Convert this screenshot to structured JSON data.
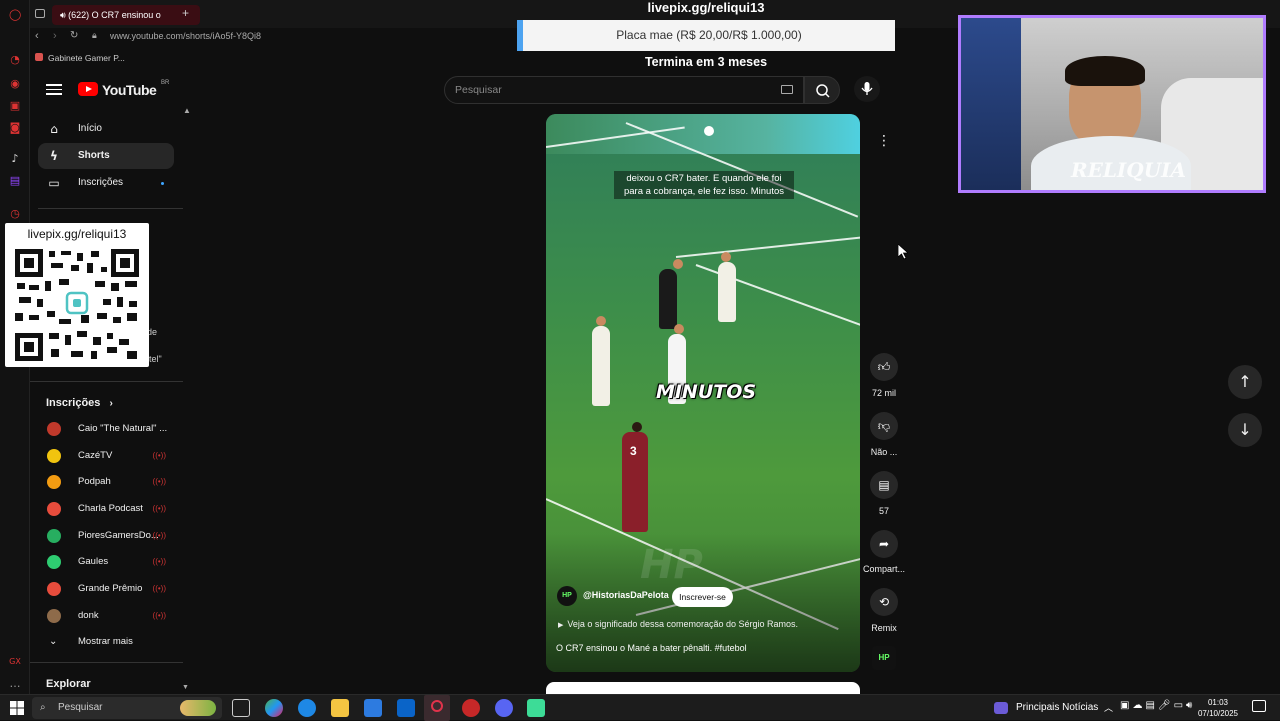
{
  "browser": {
    "tab_title": "(622) O CR7 ensinou o",
    "url": "www.youtube.com/shorts/iAo5f-Y8Qi8",
    "bookmark": "Gabinete Gamer P..."
  },
  "youtube": {
    "logo_text": "YouTube",
    "region": "BR",
    "search_placeholder": "Pesquisar",
    "nav": [
      {
        "label": "Início",
        "icon": "home-icon"
      },
      {
        "label": "Shorts",
        "icon": "shorts-icon"
      },
      {
        "label": "Inscrições",
        "icon": "subscriptions-icon"
      }
    ],
    "partial_sidebar_text": [
      "de",
      "tel\""
    ],
    "subscriptions_header": "Inscrições",
    "subscriptions": [
      {
        "name": "Caio \"The Natural\" ...",
        "color": "#c0392b",
        "live": false
      },
      {
        "name": "CazéTV",
        "color": "#f1c40f",
        "live": true
      },
      {
        "name": "Podpah",
        "color": "#f39c12",
        "live": true
      },
      {
        "name": "Charla Podcast",
        "color": "#e74c3c",
        "live": true
      },
      {
        "name": "PioresGamersDo...",
        "color": "#27ae60",
        "live": true
      },
      {
        "name": "Gaules",
        "color": "#2ecc71",
        "live": true
      },
      {
        "name": "Grande Prêmio",
        "color": "#e74c3c",
        "live": true
      },
      {
        "name": "donk",
        "color": "#8e6b4a",
        "live": true
      }
    ],
    "show_more": "Mostrar mais",
    "explore_header": "Explorar",
    "short": {
      "caption": "deixou o CR7 bater. E quando ele foi para a cobrança, ele fez isso. Minutos",
      "big_caption": "MINUTOS",
      "watermark": "HP",
      "channel_avatar": "HP",
      "channel": "@HistoriasDaPelota",
      "subscribe": "Inscrever-se",
      "description": "Veja o significado dessa comemoração do Sérgio Ramos.",
      "title": "O CR7 ensinou o Mané a bater pênalti. #futebol",
      "player_number": "3"
    },
    "actions": {
      "likes": "72 mil",
      "dislike": "Não ...",
      "comments": "57",
      "share": "Compart...",
      "remix": "Remix",
      "audio_badge": "HP"
    }
  },
  "overlay": {
    "donation_url": "livepix.gg/reliqui13",
    "goal": "Placa mae (R$ 20,00/R$ 1.000,00)",
    "goal_end": "Termina em 3 meses",
    "qr_url": "livepix.gg/reliqui13",
    "webcam_name": "RELIQUIA"
  },
  "taskbar": {
    "search": "Pesquisar",
    "news": "Principais Notícias",
    "time": "01:03",
    "date": "07/10/2025"
  },
  "colors": {
    "accent_red": "#ff0000",
    "webcam_border": "#b07cff",
    "goal_accent": "#4da3f0"
  }
}
